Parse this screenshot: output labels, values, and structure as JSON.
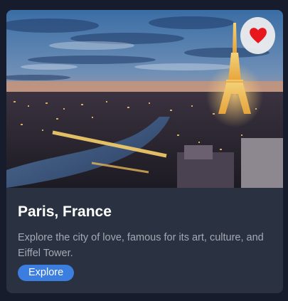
{
  "card": {
    "image_alt": "Paris skyline at dusk with the illuminated Eiffel Tower and the Seine river",
    "favorite_icon": "heart-icon",
    "favorite_color": "#e8161d",
    "title": "Paris, France",
    "description": "Explore the city of love, famous for its art, culture, and Eiffel Tower.",
    "button_label": "Explore",
    "button_color": "#3b7ee0"
  }
}
